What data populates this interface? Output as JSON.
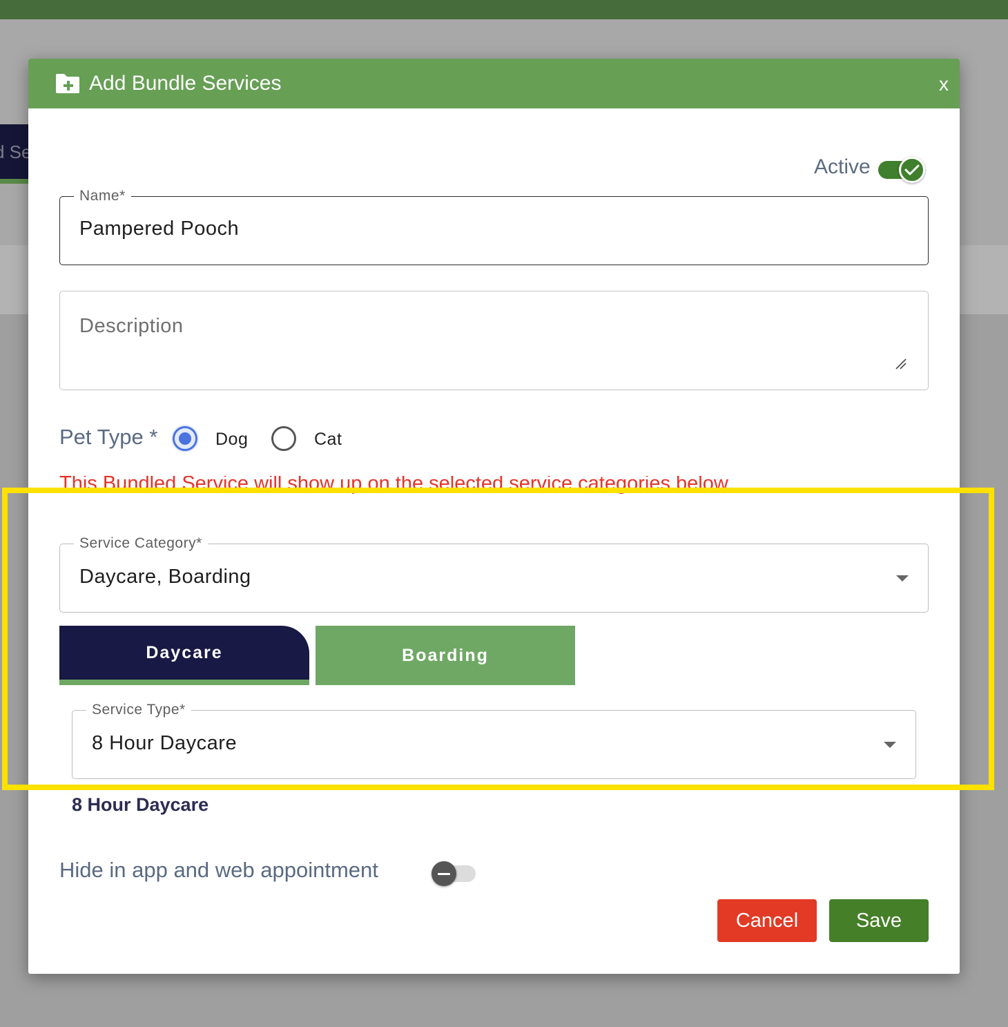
{
  "background": {
    "tab_fragment": "d Se"
  },
  "modal": {
    "title": "Add Bundle Services",
    "close_label": "x",
    "header_icon": "folder-plus-icon",
    "active_label": "Active",
    "active": true,
    "name": {
      "legend": "Name*",
      "value": "Pampered Pooch"
    },
    "description": {
      "placeholder": "Description"
    },
    "pet_type": {
      "label": "Pet Type *",
      "options": [
        "Dog",
        "Cat"
      ],
      "selected": "Dog"
    },
    "notice": "This Bundled Service will show up on the selected service categories below",
    "service_category": {
      "legend": "Service Category*",
      "value": "Daycare, Boarding"
    },
    "tabs": [
      {
        "label": "Daycare",
        "active": true
      },
      {
        "label": "Boarding",
        "active": false
      }
    ],
    "service_type": {
      "legend": "Service Type*",
      "value": "8 Hour Daycare"
    },
    "selected_service": "8 Hour Daycare",
    "hide_label": "Hide in app and web appointment",
    "hide": false,
    "cancel_label": "Cancel",
    "save_label": "Save"
  },
  "colors": {
    "header": "#679f55",
    "daycare_tab": "#181944",
    "boarding_tab": "#6fa865",
    "cancel": "#e23a24",
    "save": "#457f28",
    "notice": "#e4342a",
    "highlight": "#ffe100"
  }
}
